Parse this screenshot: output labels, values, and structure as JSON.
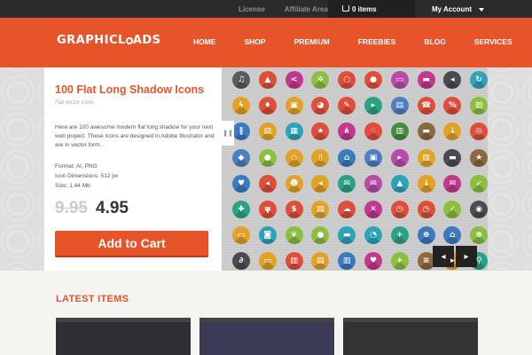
{
  "topbar": {
    "links": [
      "License",
      "Affiliate Area"
    ],
    "cart_label": "0 items",
    "account_label": "My Account"
  },
  "header": {
    "logo_text_pre": "GRAPHICL",
    "logo_text_post": "ADS",
    "nav": [
      "HOME",
      "SHOP",
      "PREMIUM",
      "FREEBIES",
      "BLOG",
      "SERVICES"
    ]
  },
  "product": {
    "title": "100 Flat Long Shadow Icons",
    "subtitle": "Flat vector icons",
    "description": "Here are 100 awesome modern flat long shadow for your next web project. These icons are designed in Adobe Illustrator and are in vector form.",
    "format": "Format: AI, PNG",
    "dimensions": "Icon Dimensions: 512 px",
    "size": "Size: 1.44 Mb",
    "old_price": "9.95",
    "new_price": "4.95",
    "add_to_cart": "Add to Cart"
  },
  "gallery": {
    "icon_colors": [
      [
        "#5a5a63",
        "#e04e3a",
        "#c2388e",
        "#8cbf3f",
        "#e04e3a",
        "#e04e3a",
        "#b84aa8",
        "#c2388e",
        "#4a4a52",
        "#2ba3b8"
      ],
      [
        "#e2a226",
        "#e04e3a",
        "#e2a226",
        "#e04e3a",
        "#e04e3a",
        "#2aa384",
        "#4d7fbf",
        "#e04e3a",
        "#e04e3a",
        "#8cbf3f"
      ],
      [
        "#3a7bbf",
        "#e2a226",
        "#2ba3b8",
        "#e04e3a",
        "#c2388e",
        "#e04e3a",
        "#4a8b3f",
        "#8c6a3f",
        "#e2a226",
        "#e04e3a"
      ],
      [
        "#4d7fbf",
        "#8cbf3f",
        "#e2a226",
        "#e2a226",
        "#3a7bbf",
        "#4d7fbf",
        "#b84aa8",
        "#e2a226",
        "#4a4a52",
        "#8c6a3f"
      ],
      [
        "#3a7bbf",
        "#e04e3a",
        "#e2a226",
        "#e2a226",
        "#2aa384",
        "#b84aa8",
        "#2ba3b8",
        "#e2a226",
        "#c2388e",
        "#8cbf3f"
      ],
      [
        "#2aa384",
        "#e04e3a",
        "#e04e3a",
        "#e2a226",
        "#e04e3a",
        "#c2388e",
        "#e04e3a",
        "#e04e3a",
        "#8cbf3f",
        "#4a4a52"
      ],
      [
        "#e2a226",
        "#2ba3b8",
        "#8cbf3f",
        "#8cbf3f",
        "#2ba3b8",
        "#2ba3b8",
        "#2aa384",
        "#3a7bbf",
        "#3a7bbf",
        "#8cbf3f"
      ],
      [
        "#4a4a52",
        "#e2a226",
        "#e04e3a",
        "#e2a226",
        "#3a7bbf",
        "#c2388e",
        "#8cbf3f",
        "#8c6a3f",
        "#e2a226",
        "#2aa384"
      ]
    ],
    "icon_glyphs": [
      [
        "headphones-icon",
        "bag-icon",
        "share-icon",
        "gear-icon",
        "ring-icon",
        "circle-icon",
        "ticket-icon",
        "chat-icon",
        "rewind-icon",
        "refresh-icon"
      ],
      [
        "lightning-icon",
        "drop-icon",
        "lock-icon",
        "palette-icon",
        "pencil-icon",
        "play-icon",
        "book-icon",
        "phone-icon",
        "percent-icon",
        "chart-icon"
      ],
      [
        "pause-icon",
        "document-icon",
        "calendar-icon",
        "new-badge-icon",
        "network-icon",
        "bulb-icon",
        "film-icon",
        "briefcase-icon",
        "download-icon",
        "target-icon"
      ],
      [
        "tag-icon",
        "location-icon",
        "diamond-icon",
        "tablet-icon",
        "home-icon",
        "gift-icon",
        "skip-icon",
        "film-icon",
        "folder-icon",
        "star-icon"
      ],
      [
        "heart-icon",
        "back-icon",
        "user-icon",
        "back-icon",
        "mail-icon",
        "mail-open-icon",
        "triangle-icon",
        "download-icon",
        "mail-icon",
        "rocket-icon"
      ],
      [
        "puzzle-icon",
        "fork-icon",
        "money-bag-icon",
        "clipboard-icon",
        "cloud-icon",
        "close-icon",
        "clock-icon",
        "clock-icon",
        "check-icon",
        "disc-icon"
      ],
      [
        "cart-icon",
        "camera-icon",
        "leaf-icon",
        "location-icon",
        "briefcase-icon",
        "pie-icon",
        "plus-icon",
        "globe-icon",
        "bank-icon",
        "globe-icon"
      ],
      [
        "paperclip-icon",
        "ticket-icon",
        "film-icon",
        "clipboard-icon",
        "chart-icon",
        "heart-icon",
        "plus-icon",
        "list-icon",
        "next-icon",
        "search-icon"
      ]
    ],
    "prev_label": "◂",
    "next_label": "▸"
  },
  "latest": {
    "heading": "LATEST ITEMS"
  },
  "colors": {
    "accent": "#e8542a",
    "topbar": "#2b2b2b"
  }
}
